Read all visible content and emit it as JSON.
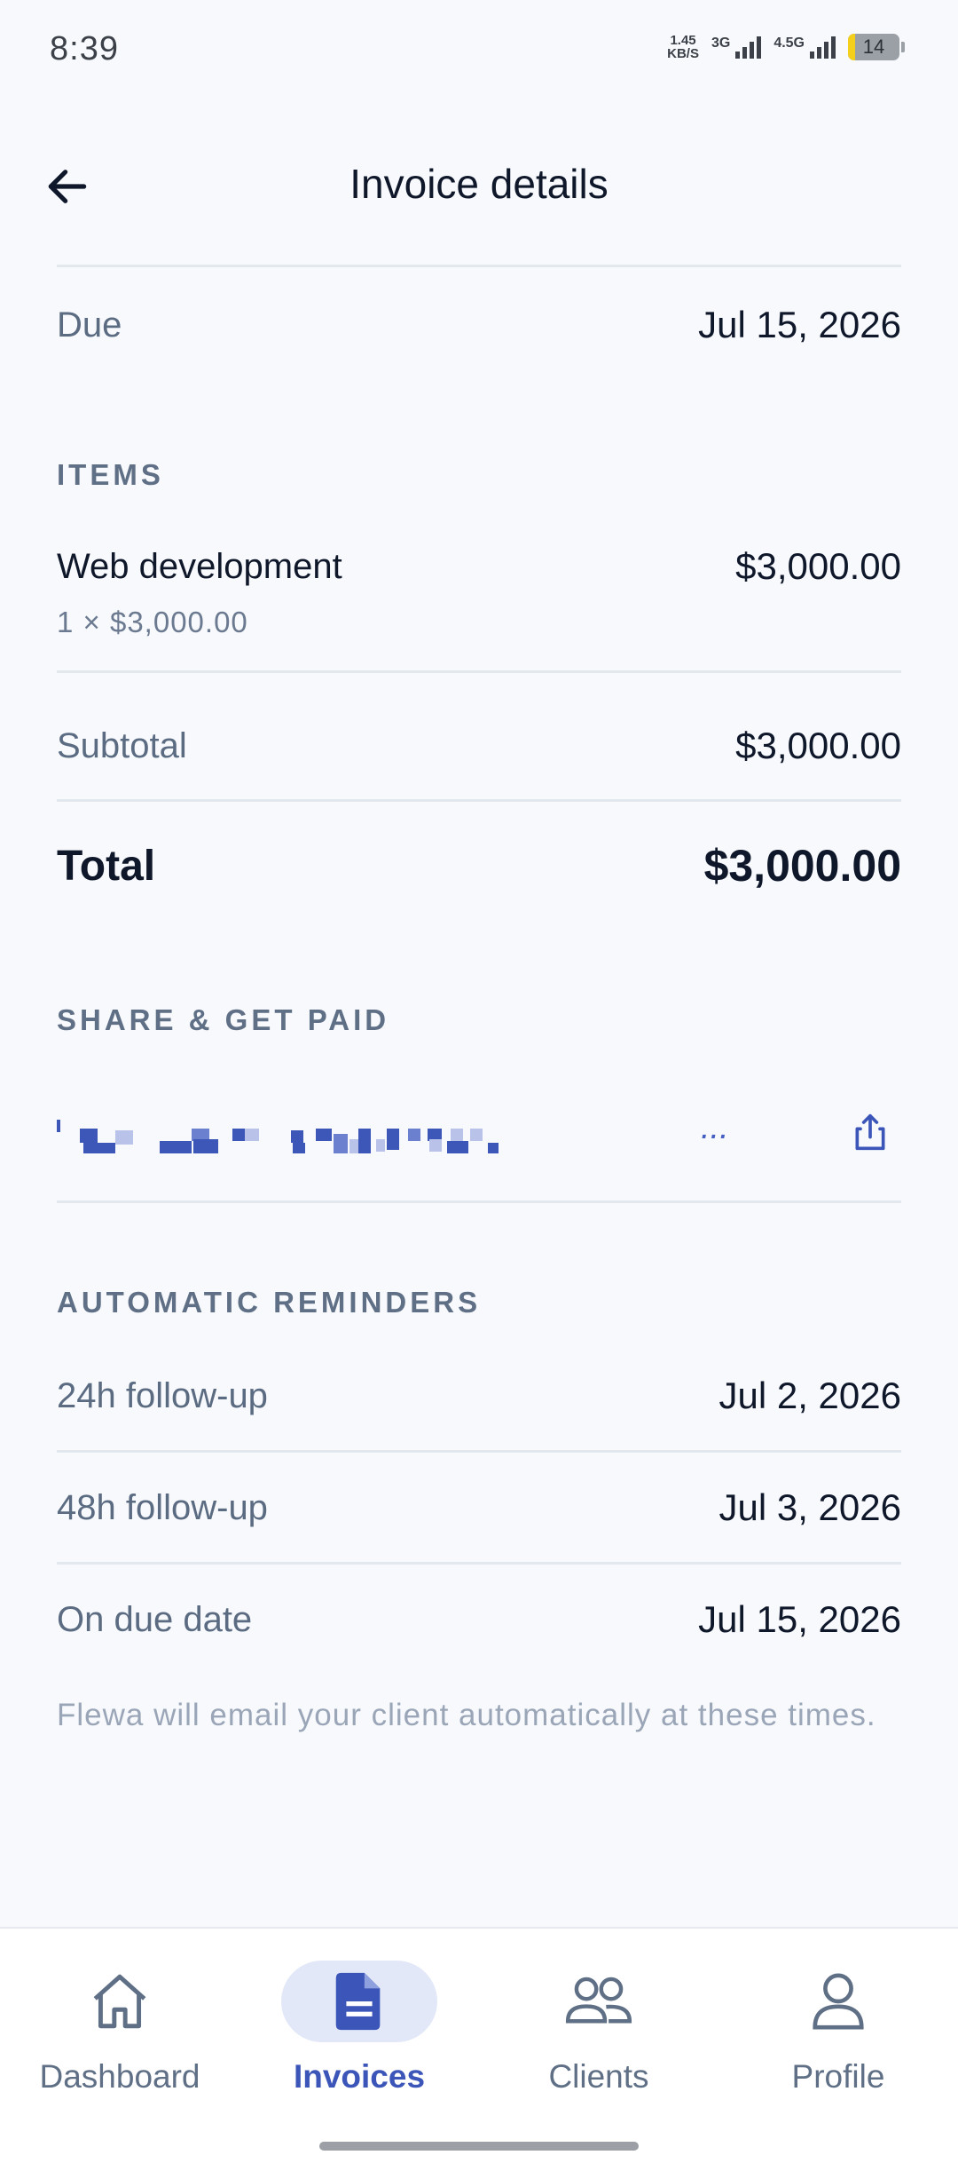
{
  "status_bar": {
    "time": "8:39",
    "net_speed_top": "1.45",
    "net_speed_bottom": "KB/S",
    "signal1": "3G",
    "signal2": "4.5G",
    "battery": "14"
  },
  "header": {
    "title": "Invoice details",
    "back_icon": "arrow-left-icon"
  },
  "due": {
    "label": "Due",
    "value": "Jul 15, 2026"
  },
  "items_section": {
    "heading": "ITEMS",
    "items": [
      {
        "name": "Web development",
        "detail": "1 × $3,000.00",
        "amount": "$3,000.00"
      }
    ]
  },
  "subtotal": {
    "label": "Subtotal",
    "value": "$3,000.00"
  },
  "total": {
    "label": "Total",
    "value": "$3,000.00"
  },
  "share_section": {
    "heading": "SHARE & GET PAID",
    "link_suffix": "...",
    "share_icon": "share-icon"
  },
  "reminders_section": {
    "heading": "AUTOMATIC REMINDERS",
    "reminders": [
      {
        "label": "24h follow-up",
        "date": "Jul 2, 2026"
      },
      {
        "label": "48h follow-up",
        "date": "Jul 3, 2026"
      },
      {
        "label": "On due date",
        "date": "Jul 15, 2026"
      }
    ],
    "footnote": "Flewa will email your client automatically at these times."
  },
  "bottom_nav": {
    "items": [
      {
        "label": "Dashboard",
        "icon": "home-icon",
        "active": false
      },
      {
        "label": "Invoices",
        "icon": "document-icon",
        "active": true
      },
      {
        "label": "Clients",
        "icon": "users-icon",
        "active": false
      },
      {
        "label": "Profile",
        "icon": "user-icon",
        "active": false
      }
    ]
  },
  "colors": {
    "accent": "#3b55b8",
    "background": "#f7f9fc",
    "muted_text": "#5f6f86"
  }
}
